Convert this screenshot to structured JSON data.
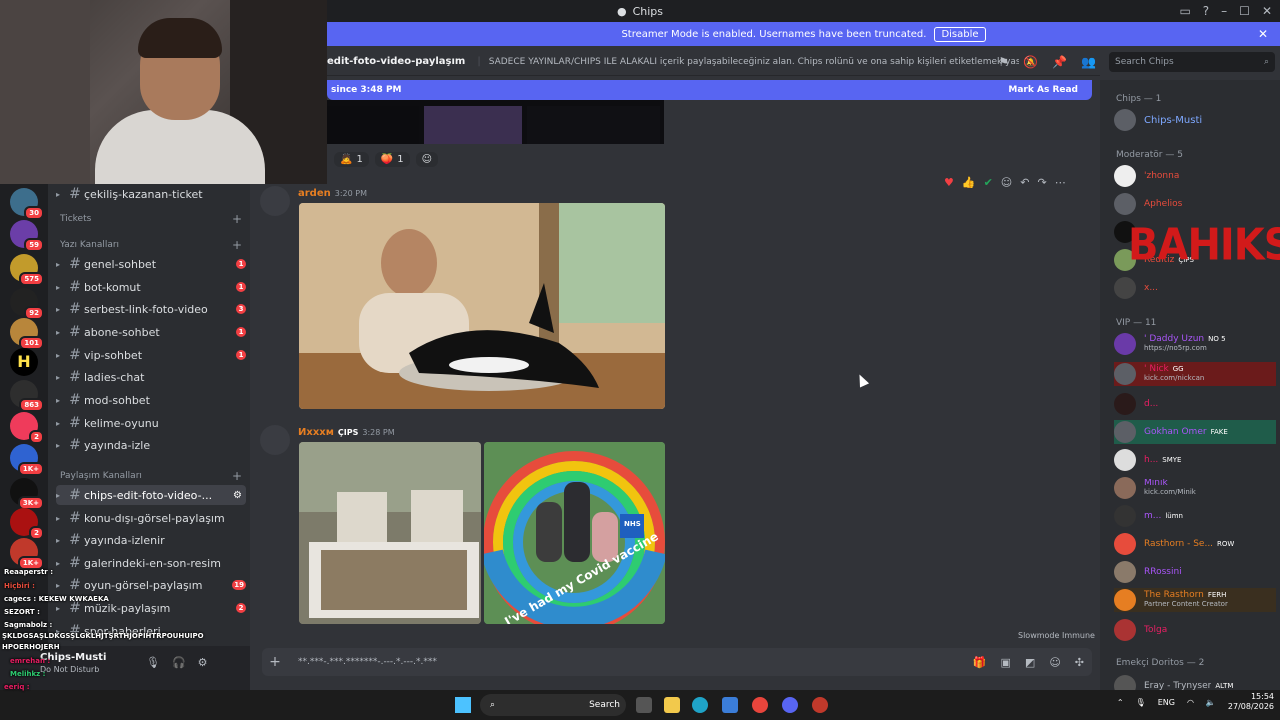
{
  "window": {
    "title": "Chips"
  },
  "banner": {
    "text": "Streamer Mode is enabled. Usernames have been truncated.",
    "button": "Disable"
  },
  "channel_header": {
    "name": "edit-foto-video-paylaşım",
    "topic": "SADECE YAYINLAR/CHIPS İLE ALAKALI içerik paylaşabileceğiniz alan. Chips rolünü ve ona sahip kişileri etiketlemek yasaktır."
  },
  "search": {
    "placeholder": "Search Chips"
  },
  "new_messages": {
    "text": "New messages since 3:48 PM",
    "visible": "since 3:48 PM",
    "action": "Mark As Read"
  },
  "reactions": [
    {
      "count": "1"
    },
    {
      "count": "1"
    }
  ],
  "messages": [
    {
      "author": "arden",
      "time": "3:20 PM",
      "color": "#e67e22"
    },
    {
      "author": "Ихххм",
      "tag": "ÇIPS",
      "time": "3:28 PM",
      "color": "#e67e22"
    }
  ],
  "covid_text": "I've had my Covid vaccine",
  "nhs_text": "NHS",
  "slowmode": "Slowmode Immune",
  "input": {
    "text": "**.***-.***.*******-.---.*.---.*.***"
  },
  "channels": {
    "top": "çekiliş-kazanan-ticket",
    "category_tickets": "Tickets",
    "category_yazi": "Yazı Kanalları",
    "category_paylasim": "Paylaşım Kanalları",
    "items": [
      {
        "label": "genel-sohbet",
        "unread": "1"
      },
      {
        "label": "bot-komut",
        "unread": "1"
      },
      {
        "label": "serbest-link-foto-video",
        "unread": "3"
      },
      {
        "label": "abone-sohbet",
        "unread": "1"
      },
      {
        "label": "vip-sohbet",
        "unread": "1"
      },
      {
        "label": "ladies-chat",
        "unread": ""
      },
      {
        "label": "mod-sohbet",
        "unread": ""
      },
      {
        "label": "kelime-oyunu",
        "unread": ""
      },
      {
        "label": "yayında-izle",
        "unread": ""
      }
    ],
    "paylasim_items": [
      {
        "label": "chips-edit-foto-video-...",
        "unread": ""
      },
      {
        "label": "konu-dışı-görsel-paylaşım",
        "unread": ""
      },
      {
        "label": "yayında-izlenir",
        "unread": ""
      },
      {
        "label": "galerindeki-en-son-resim",
        "unread": ""
      },
      {
        "label": "oyun-görsel-paylaşım",
        "unread": "19"
      },
      {
        "label": "müzik-paylaşım",
        "unread": "2"
      },
      {
        "label": "spor-haberleri",
        "unread": ""
      }
    ]
  },
  "servers": [
    {
      "badge": "30"
    },
    {
      "badge": "59"
    },
    {
      "badge": "575"
    },
    {
      "badge": "92"
    },
    {
      "badge": "101"
    },
    {
      "badge": ""
    },
    {
      "badge": "863"
    },
    {
      "badge": "2"
    },
    {
      "badge": "1K+"
    },
    {
      "badge": "3K+"
    },
    {
      "badge": "2"
    },
    {
      "badge": "1K+"
    }
  ],
  "user_panel": {
    "name": "Chips-Musti",
    "status": "Do Not Disturb"
  },
  "stream_chat": [
    "Reaaperstr :",
    "Hiçbiri :",
    "cagecs : KEKEW KWKAEKA",
    "SEZORT :",
    "Sagmabolz :",
    "ŞKLDGSAŞLDKGSŞLGKLHJTŞRTHJOPIHTRPOUHUIPO",
    "HPOERHOJERH",
    "emrehan :",
    "Melihkz :",
    "eeriq :",
    "Denemez :"
  ],
  "members": {
    "cat_chips": "Chips — 1",
    "cat_mod": "Moderatör — 5",
    "cat_vip": "VIP — 11",
    "cat_emekci": "Emekçi Doritos — 2",
    "chips": [
      {
        "name": "Chips-Musti"
      }
    ],
    "mods": [
      {
        "name": "'zhonna"
      },
      {
        "name": "Aphelios"
      },
      {
        "name": ""
      },
      {
        "name": "Reditiz",
        "badge": "ÇIPS"
      },
      {
        "name": "x..."
      }
    ],
    "vips": [
      {
        "name": "' Daddy Uzun",
        "badge": "NO 5",
        "sub": "https://no5rp.com"
      },
      {
        "name": "' Nick",
        "badge": "GG",
        "sub": "kick.com/nickcan"
      },
      {
        "name": "d..."
      },
      {
        "name": "Gokhan Omer",
        "badge": "FAKE"
      },
      {
        "name": "h...",
        "badge": "SMYE"
      },
      {
        "name": "Minik",
        "sub": "kick.com/Minik"
      },
      {
        "name": "m...",
        "badge": "lümn"
      },
      {
        "name": "Rasthorn - Se...",
        "badge": "ROW"
      },
      {
        "name": "RRossini"
      },
      {
        "name": "The Rasthorn",
        "badge": "FERH",
        "sub": "Partner Content Creator"
      },
      {
        "name": "Tolga"
      }
    ],
    "emekci": [
      {
        "name": "Eray - Trynyser",
        "badge": "ALTM"
      }
    ]
  },
  "overlay_logo": "BAHIKS",
  "taskbar": {
    "search": "Search",
    "lang": "ENG",
    "time": "15:54",
    "date": "27/08/2026"
  }
}
